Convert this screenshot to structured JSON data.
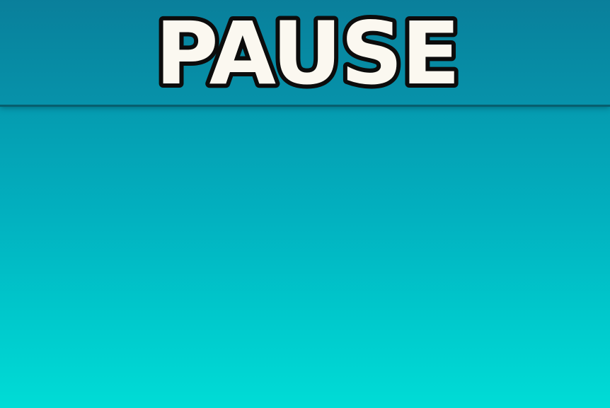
{
  "pause_menu": {
    "title": "PAUSE"
  },
  "colors": {
    "header_background": "#0886a0",
    "background_top": "#0792a6",
    "background_bottom": "#00dcd6",
    "title_fill": "#fbf8f0",
    "title_outline": "#0c0c0c"
  }
}
